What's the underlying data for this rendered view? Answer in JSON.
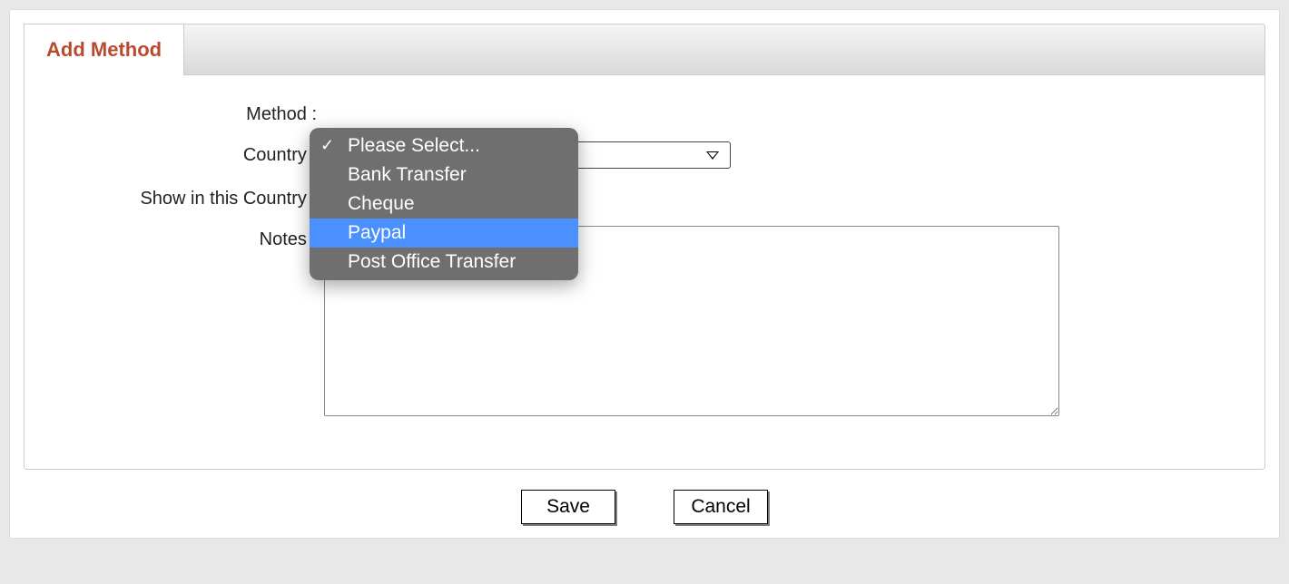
{
  "tab": {
    "label": "Add Method"
  },
  "form": {
    "method_label": "Method :",
    "country_label": "Country :",
    "show_country_label": "Show in this Country :",
    "notes_label": "Notes :",
    "notes_value": ""
  },
  "dropdown": {
    "selected_index": 0,
    "highlighted_index": 3,
    "options": [
      "Please Select...",
      "Bank Transfer",
      "Cheque",
      "Paypal",
      "Post Office Transfer"
    ]
  },
  "buttons": {
    "save": "Save",
    "cancel": "Cancel"
  }
}
